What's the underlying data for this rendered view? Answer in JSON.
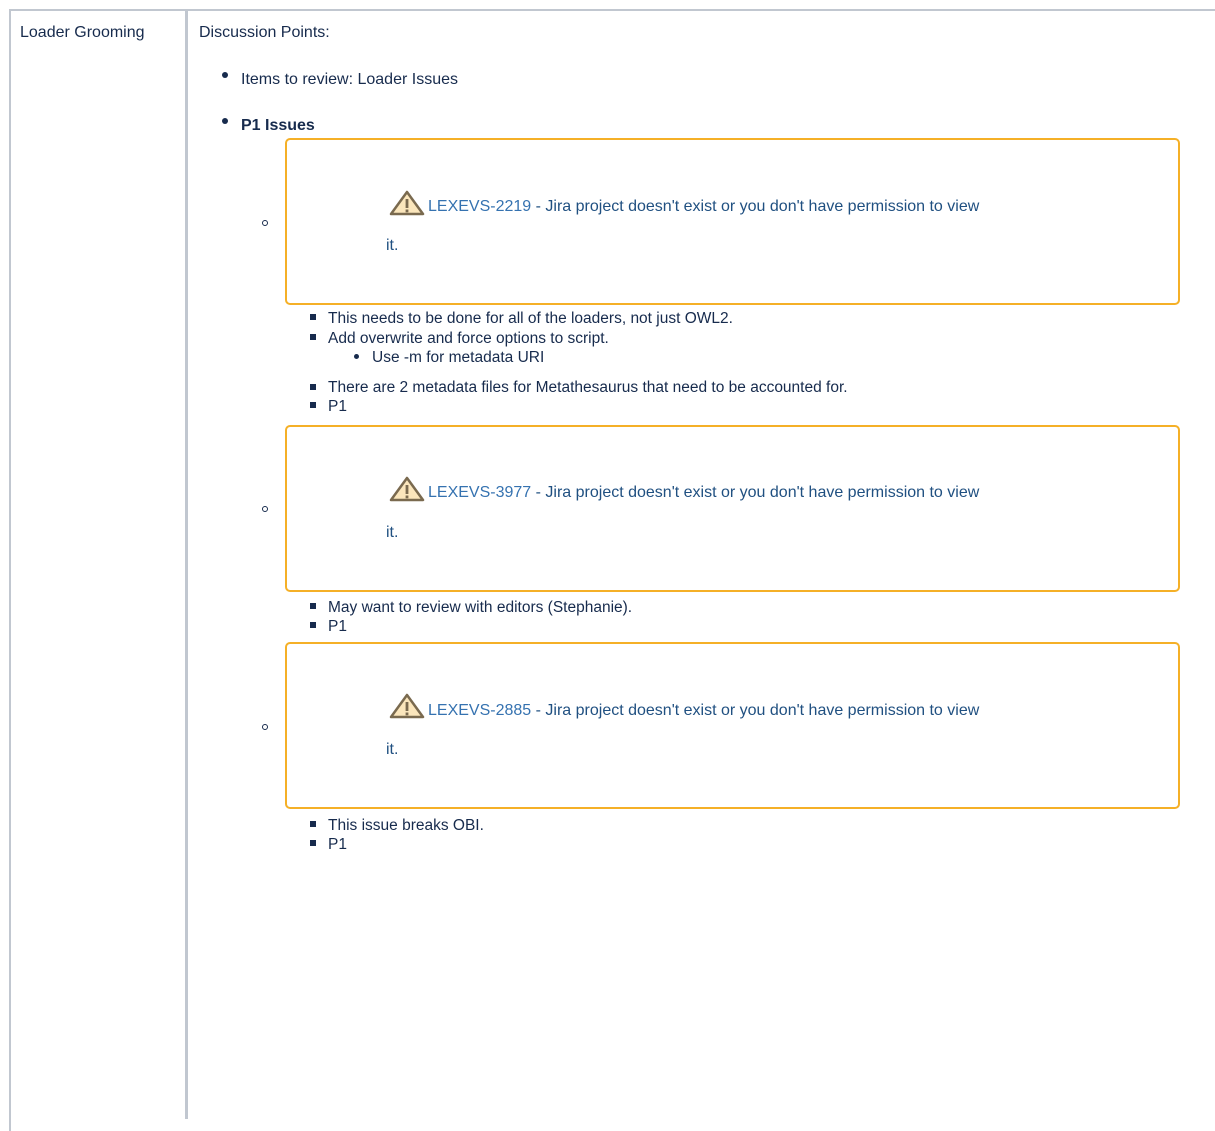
{
  "table": {
    "row_label": "Loader Grooming",
    "header": "Discussion Points:"
  },
  "items": {
    "review": "Items to review: Loader Issues",
    "p1_heading": "P1 Issues"
  },
  "jira_issues": [
    {
      "key": "LEXEVS-2219",
      "message": " - Jira project doesn't exist or you don't have permission to view",
      "wrap": "it.",
      "notes": [
        "This needs to be done for all of the loaders, not just OWL2.",
        "Add overwrite and force options to script.",
        "Use -m for metadata URI",
        "There are 2 metadata files for Metathesaurus that need to be accounted for.",
        "P1"
      ]
    },
    {
      "key": "LEXEVS-3977",
      "message": " - Jira project doesn't exist or you don't have permission to view",
      "wrap": "it.",
      "notes": [
        "May want to review with editors (Stephanie).",
        "P1"
      ]
    },
    {
      "key": "LEXEVS-2885",
      "message": " - Jira project doesn't exist or you don't have permission to view",
      "wrap": "it.",
      "notes": [
        "This issue breaks OBI.",
        "P1"
      ]
    }
  ],
  "icons": {
    "warning": "warning-icon"
  },
  "colors": {
    "border": "#c1c7d0",
    "jira_box": "#f5b027",
    "link": "#3572b0",
    "text": "#172b4d"
  }
}
